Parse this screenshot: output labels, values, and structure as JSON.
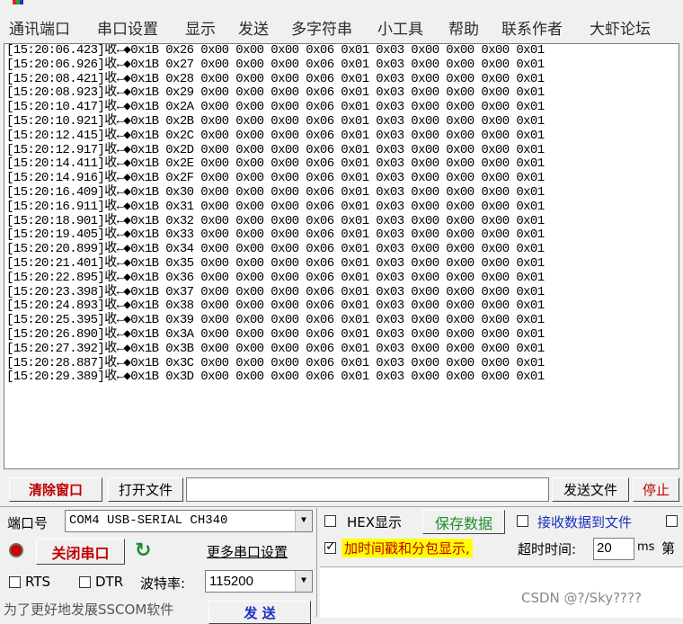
{
  "menu": [
    "通讯端口",
    "串口设置",
    "显示",
    "发送",
    "多字符串",
    "小工具",
    "帮助",
    "联系作者",
    "大虾论坛"
  ],
  "log_lines": [
    "[15:20:06.423]收←◆0x1B 0x26 0x00 0x00 0x00 0x06 0x01 0x03 0x00 0x00 0x00 0x01",
    "[15:20:06.926]收←◆0x1B 0x27 0x00 0x00 0x00 0x06 0x01 0x03 0x00 0x00 0x00 0x01",
    "[15:20:08.421]收←◆0x1B 0x28 0x00 0x00 0x00 0x06 0x01 0x03 0x00 0x00 0x00 0x01",
    "[15:20:08.923]收←◆0x1B 0x29 0x00 0x00 0x00 0x06 0x01 0x03 0x00 0x00 0x00 0x01",
    "[15:20:10.417]收←◆0x1B 0x2A 0x00 0x00 0x00 0x06 0x01 0x03 0x00 0x00 0x00 0x01",
    "[15:20:10.921]收←◆0x1B 0x2B 0x00 0x00 0x00 0x06 0x01 0x03 0x00 0x00 0x00 0x01",
    "[15:20:12.415]收←◆0x1B 0x2C 0x00 0x00 0x00 0x06 0x01 0x03 0x00 0x00 0x00 0x01",
    "[15:20:12.917]收←◆0x1B 0x2D 0x00 0x00 0x00 0x06 0x01 0x03 0x00 0x00 0x00 0x01",
    "[15:20:14.411]收←◆0x1B 0x2E 0x00 0x00 0x00 0x06 0x01 0x03 0x00 0x00 0x00 0x01",
    "[15:20:14.916]收←◆0x1B 0x2F 0x00 0x00 0x00 0x06 0x01 0x03 0x00 0x00 0x00 0x01",
    "[15:20:16.409]收←◆0x1B 0x30 0x00 0x00 0x00 0x06 0x01 0x03 0x00 0x00 0x00 0x01",
    "[15:20:16.911]收←◆0x1B 0x31 0x00 0x00 0x00 0x06 0x01 0x03 0x00 0x00 0x00 0x01",
    "[15:20:18.901]收←◆0x1B 0x32 0x00 0x00 0x00 0x06 0x01 0x03 0x00 0x00 0x00 0x01",
    "[15:20:19.405]收←◆0x1B 0x33 0x00 0x00 0x00 0x06 0x01 0x03 0x00 0x00 0x00 0x01",
    "[15:20:20.899]收←◆0x1B 0x34 0x00 0x00 0x00 0x06 0x01 0x03 0x00 0x00 0x00 0x01",
    "[15:20:21.401]收←◆0x1B 0x35 0x00 0x00 0x00 0x06 0x01 0x03 0x00 0x00 0x00 0x01",
    "[15:20:22.895]收←◆0x1B 0x36 0x00 0x00 0x00 0x06 0x01 0x03 0x00 0x00 0x00 0x01",
    "[15:20:23.398]收←◆0x1B 0x37 0x00 0x00 0x00 0x06 0x01 0x03 0x00 0x00 0x00 0x01",
    "[15:20:24.893]收←◆0x1B 0x38 0x00 0x00 0x00 0x06 0x01 0x03 0x00 0x00 0x00 0x01",
    "[15:20:25.395]收←◆0x1B 0x39 0x00 0x00 0x00 0x06 0x01 0x03 0x00 0x00 0x00 0x01",
    "[15:20:26.890]收←◆0x1B 0x3A 0x00 0x00 0x00 0x06 0x01 0x03 0x00 0x00 0x00 0x01",
    "[15:20:27.392]收←◆0x1B 0x3B 0x00 0x00 0x00 0x06 0x01 0x03 0x00 0x00 0x00 0x01",
    "[15:20:28.887]收←◆0x1B 0x3C 0x00 0x00 0x00 0x06 0x01 0x03 0x00 0x00 0x00 0x01",
    "[15:20:29.389]收←◆0x1B 0x3D 0x00 0x00 0x00 0x06 0x01 0x03 0x00 0x00 0x00 0x01"
  ],
  "toolbar": {
    "clear_window": "清除窗口",
    "open_file": "打开文件",
    "file_path": "",
    "send_file": "发送文件",
    "stop": "停止"
  },
  "port": {
    "label": "端口号",
    "value": "COM4 USB-SERIAL CH340",
    "close_port": "关闭串口",
    "more_settings": "更多串口设置",
    "rts": "RTS",
    "dtr": "DTR",
    "baud_label": "波特率:",
    "baud_value": "115200"
  },
  "options": {
    "hex_display": "HEX显示",
    "save_data": "保存数据",
    "receive_to_file": "接收数据到文件",
    "add_timestamp": "加时间戳和分包显示,",
    "timeout_label": "超时时间:",
    "timeout_value": "20",
    "timeout_unit": "ms",
    "nth": "第"
  },
  "footer": {
    "promo": "为了更好地发展SSCOM软件",
    "send": "发 送"
  },
  "watermark": "CSDN @?/Sky????",
  "colors": {
    "accent_red": "#c00000",
    "accent_green": "#1a8f2a",
    "accent_blue": "#1b2fbf",
    "highlight": "#ffff00"
  }
}
